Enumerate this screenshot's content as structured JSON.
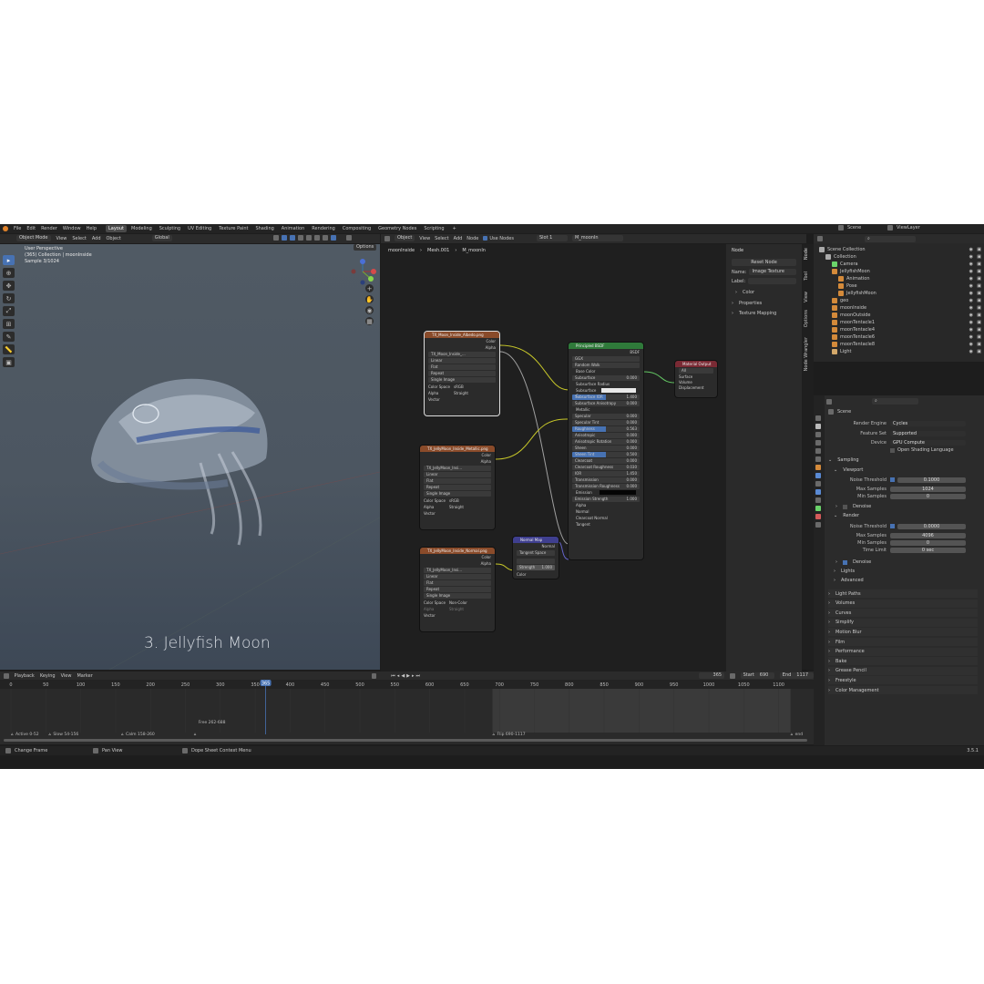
{
  "topbar": {
    "menus": [
      "File",
      "Edit",
      "Render",
      "Window",
      "Help"
    ],
    "workspaces": [
      "Layout",
      "Modeling",
      "Sculpting",
      "UV Editing",
      "Texture Paint",
      "Shading",
      "Animation",
      "Rendering",
      "Compositing",
      "Geometry Nodes",
      "Scripting"
    ],
    "active_workspace": "Layout",
    "scene": "Scene",
    "view_layer": "ViewLayer"
  },
  "viewport": {
    "header": {
      "mode": "Object Mode",
      "menus": [
        "View",
        "Select",
        "Add",
        "Object"
      ],
      "orientation": "Global"
    },
    "options_label": "Options",
    "overlay_lines": [
      "User Perspective",
      "(365) Collection | moonInside",
      "Sample 3/1024"
    ],
    "caption": "3. Jellyfish Moon",
    "gizmo": {
      "x": "X",
      "y": "Y",
      "z": "Z"
    }
  },
  "node_editor": {
    "header": {
      "type": "Object",
      "menus": [
        "View",
        "Select",
        "Add",
        "Node"
      ],
      "use_nodes": "Use Nodes",
      "slot": "Slot 1",
      "material": "M_moonIn"
    },
    "breadcrumb": [
      "moonInside",
      "Mesh.001",
      "M_moonIn"
    ],
    "image_nodes": [
      {
        "title": "TX_Moon_Inside_Albedo.png",
        "image": "TX_Moon_Inside_...",
        "rows": [
          "Linear",
          "Flat",
          "Repeat",
          "Single Image"
        ],
        "color_space": "sRGB",
        "alpha": "Straight",
        "out": [
          "Color",
          "Alpha"
        ],
        "in": "Vector",
        "cs_label": "Color Space",
        "alpha_label": "Alpha"
      },
      {
        "title": "TX_JellyMoon_Inside_Metallic.png",
        "image": "TX_JellyMoon_Insi...",
        "rows": [
          "Linear",
          "Flat",
          "Repeat",
          "Single Image"
        ],
        "color_space": "sRGB",
        "alpha": "Straight",
        "out": [
          "Color",
          "Alpha"
        ],
        "in": "Vector",
        "cs_label": "Color Space",
        "alpha_label": "Alpha"
      },
      {
        "title": "TX_JellyMoon_Inside_Normal.png",
        "image": "TX_JellyMoon_Insi...",
        "rows": [
          "Linear",
          "Flat",
          "Repeat",
          "Single Image"
        ],
        "color_space": "Non-Color",
        "alpha": "Straight",
        "out": [
          "Color",
          "Alpha"
        ],
        "in": "Vector",
        "cs_label": "Color Space",
        "alpha_label": "Alpha"
      }
    ],
    "normal_map": {
      "title": "Normal Map",
      "out": "Normal",
      "space": "Tangent Space",
      "strength_label": "Strength",
      "strength": "1.000",
      "in": "Color"
    },
    "bsdf": {
      "title": "Principled BSDF",
      "out": "BSDF",
      "dist": "GGX",
      "sss": "Random Walk",
      "rows": [
        {
          "label": "Base Color",
          "value": ""
        },
        {
          "label": "Subsurface",
          "value": "0.000"
        },
        {
          "label": "Subsurface Radius",
          "value": ""
        },
        {
          "label": "Subsurface C...",
          "value": ""
        },
        {
          "label": "Subsurface IOR",
          "value": "1.400"
        },
        {
          "label": "Subsurface Anisotropy",
          "value": "0.000"
        },
        {
          "label": "Metallic",
          "value": ""
        },
        {
          "label": "Specular",
          "value": "0.000"
        },
        {
          "label": "Specular Tint",
          "value": "0.000"
        },
        {
          "label": "Roughness",
          "value": "0.563"
        },
        {
          "label": "Anisotropic",
          "value": "0.000"
        },
        {
          "label": "Anisotropic Rotation",
          "value": "0.000"
        },
        {
          "label": "Sheen",
          "value": "0.000"
        },
        {
          "label": "Sheen Tint",
          "value": "0.500"
        },
        {
          "label": "Clearcoat",
          "value": "0.000"
        },
        {
          "label": "Clearcoat Roughness",
          "value": "0.030"
        },
        {
          "label": "IOR",
          "value": "1.450"
        },
        {
          "label": "Transmission",
          "value": "0.000"
        },
        {
          "label": "Transmission Roughness",
          "value": "0.000"
        },
        {
          "label": "Emission",
          "value": ""
        },
        {
          "label": "Emission Strength",
          "value": "1.000"
        },
        {
          "label": "Alpha",
          "value": ""
        },
        {
          "label": "Normal",
          "value": ""
        },
        {
          "label": "Clearcoat Normal",
          "value": ""
        },
        {
          "label": "Tangent",
          "value": ""
        }
      ]
    },
    "output": {
      "title": "Material Output",
      "target": "All",
      "in": [
        "Surface",
        "Volume",
        "Displacement"
      ]
    }
  },
  "npanel": {
    "section": "Node",
    "reset": "Reset Node",
    "name_label": "Name:",
    "name": "Image Texture",
    "label_label": "Label:",
    "subsections": [
      "Color",
      "Properties",
      "Texture Mapping"
    ],
    "tabs": [
      "Node",
      "Tool",
      "View",
      "Options",
      "Node Wrangler"
    ]
  },
  "outliner": {
    "items": [
      {
        "name": "Scene Collection",
        "d": 0
      },
      {
        "name": "Collection",
        "d": 1
      },
      {
        "name": "Camera",
        "d": 2
      },
      {
        "name": "JellyfishMoon",
        "d": 2
      },
      {
        "name": "Animation",
        "d": 3
      },
      {
        "name": "Pose",
        "d": 3
      },
      {
        "name": "JellyfishMoon",
        "d": 3
      },
      {
        "name": "geo",
        "d": 2
      },
      {
        "name": "moonInside",
        "d": 2
      },
      {
        "name": "moonOutside",
        "d": 2
      },
      {
        "name": "moonTentacle1",
        "d": 2
      },
      {
        "name": "moonTentacle4",
        "d": 2
      },
      {
        "name": "moonTentacle6",
        "d": 2
      },
      {
        "name": "moonTentacle8",
        "d": 2
      },
      {
        "name": "Light",
        "d": 2
      }
    ]
  },
  "properties": {
    "scene_label": "Scene",
    "render_engine_label": "Render Engine",
    "render_engine": "Cycles",
    "feature_set_label": "Feature Set",
    "feature_set": "Supported",
    "device_label": "Device",
    "device": "GPU Compute",
    "osl": "Open Shading Language",
    "sampling": "Sampling",
    "viewport": "Viewport",
    "v_noise_label": "Noise Threshold",
    "v_noise": "0.1000",
    "v_max_label": "Max Samples",
    "v_max": "1024",
    "v_min_label": "Min Samples",
    "v_min": "0",
    "denoise": "Denoise",
    "render": "Render",
    "r_noise_label": "Noise Threshold",
    "r_noise": "0.0000",
    "r_max_label": "Max Samples",
    "r_max": "4096",
    "r_min_label": "Min Samples",
    "r_min": "0",
    "time_limit_label": "Time Limit",
    "time_limit": "0 sec",
    "r_denoise": "Denoise",
    "lights": "Lights",
    "advanced": "Advanced",
    "panels": [
      "Light Paths",
      "Volumes",
      "Curves",
      "Simplify",
      "Motion Blur",
      "Film",
      "Performance",
      "Bake",
      "Grease Pencil",
      "Freestyle",
      "Color Management"
    ]
  },
  "timeline": {
    "menus": [
      "Playback",
      "Keying",
      "View",
      "Marker"
    ],
    "current_frame": "365",
    "start_label": "Start",
    "start": "690",
    "end_label": "End",
    "end": "1117",
    "ticks": [
      "0",
      "50",
      "100",
      "150",
      "200",
      "250",
      "300",
      "350",
      "400",
      "450",
      "500",
      "550",
      "600",
      "650",
      "700",
      "750",
      "800",
      "850",
      "900",
      "950",
      "1000",
      "1050",
      "1100"
    ],
    "markers": [
      "Active 0-52",
      "Slow 54-156",
      "Calm 158-260",
      "Free 262-688",
      "Flip 690-1117",
      "end"
    ]
  },
  "statusbar": {
    "items": [
      "Change Frame",
      "Pan View",
      "Dope Sheet Context Menu"
    ],
    "version": "3.5.1"
  }
}
